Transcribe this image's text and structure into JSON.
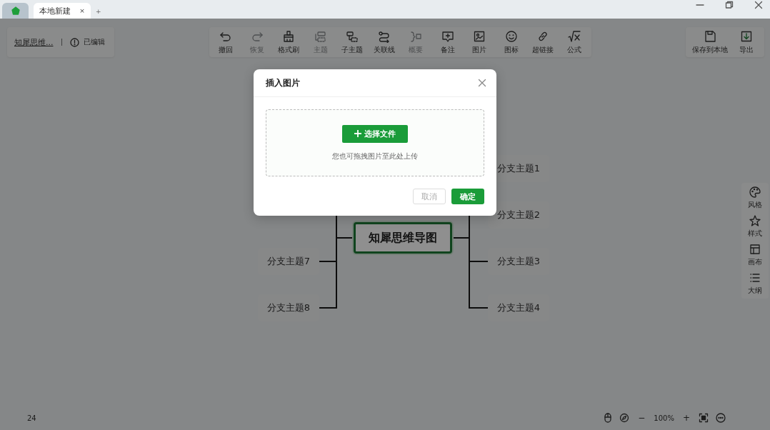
{
  "tabs": [
    {
      "kind": "home",
      "selected": false
    },
    {
      "kind": "doc",
      "label": "本地新建",
      "close": "×",
      "selected": true
    }
  ],
  "new_tab": "+",
  "header": {
    "doc_title": "知犀思维...",
    "status": "已编辑"
  },
  "toolbar": [
    {
      "label": "撤回",
      "disabled": false
    },
    {
      "label": "恢复",
      "disabled": true
    },
    {
      "label": "格式刷",
      "disabled": false
    },
    {
      "label": "主题",
      "disabled": true
    },
    {
      "label": "子主题",
      "disabled": false
    },
    {
      "label": "关联线",
      "disabled": false
    },
    {
      "label": "概要",
      "disabled": true
    },
    {
      "label": "备注",
      "disabled": false
    },
    {
      "label": "图片",
      "disabled": false
    },
    {
      "label": "图标",
      "disabled": false
    },
    {
      "label": "超链接",
      "disabled": false
    },
    {
      "label": "公式",
      "disabled": false
    }
  ],
  "file_actions": [
    {
      "label": "保存到本地"
    },
    {
      "label": "导出"
    }
  ],
  "mindmap": {
    "root": "知犀思维导图",
    "right": [
      "分支主题1",
      "分支主题2",
      "分支主题3",
      "分支主题4"
    ],
    "left": [
      "分支主题7",
      "分支主题8"
    ]
  },
  "sidebar": [
    {
      "label": "风格"
    },
    {
      "label": "样式"
    },
    {
      "label": "画布"
    },
    {
      "label": "大纲"
    }
  ],
  "status_bar": {
    "word_count": "24",
    "zoom": "100%",
    "zoom_out": "−",
    "zoom_in": "+"
  },
  "dialog": {
    "title": "插入图片",
    "choose_button": "选择文件",
    "hint": "您也可拖拽图片至此处上传",
    "cancel": "取消",
    "confirm": "确定"
  }
}
